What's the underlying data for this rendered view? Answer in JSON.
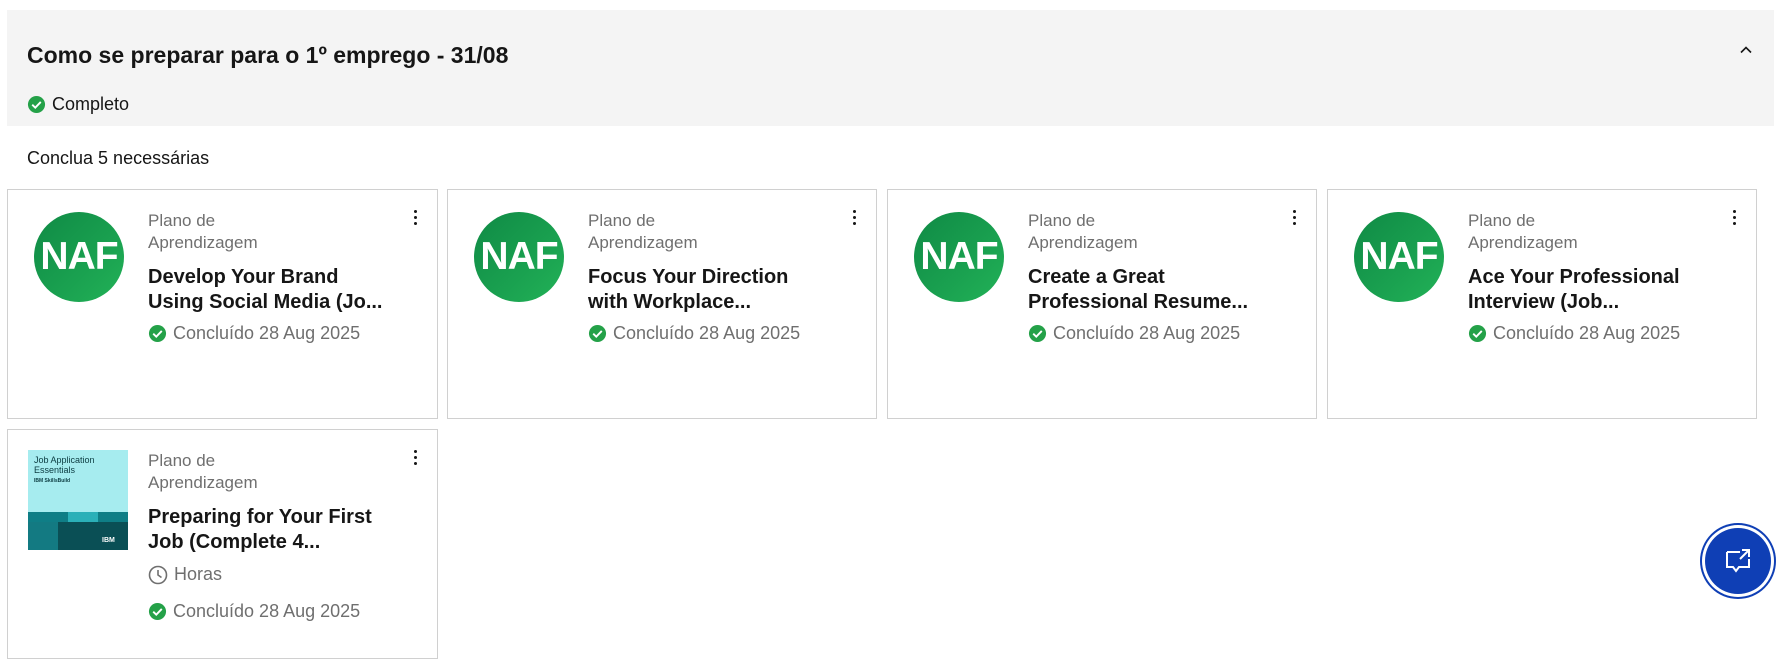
{
  "section": {
    "title": "Como se preparar para o 1º emprego - 31/08",
    "status": "Completo",
    "requirement": "Conclua 5 necessárias"
  },
  "cards": [
    {
      "kind": "Plano de Aprendizagem",
      "title": "Develop Your Brand Using Social Media (Jo...",
      "completed": "Concluído 28 Aug 2025",
      "thumb_text": "NAF"
    },
    {
      "kind": "Plano de Aprendizagem",
      "title": "Focus Your Direction with Workplace...",
      "completed": "Concluído 28 Aug 2025",
      "thumb_text": "NAF"
    },
    {
      "kind": "Plano de Aprendizagem",
      "title": "Create a Great Professional Resume...",
      "completed": "Concluído 28 Aug 2025",
      "thumb_text": "NAF"
    },
    {
      "kind": "Plano de Aprendizagem",
      "title": "Ace Your Professional Interview (Job...",
      "completed": "Concluído 28 Aug 2025",
      "thumb_text": "NAF"
    },
    {
      "kind": "Plano de Aprendizagem",
      "title": "Preparing for Your First Job (Complete 4...",
      "hours": "Horas",
      "completed": "Concluído 28 Aug 2025",
      "thumb_title": "Job Application Essentials",
      "thumb_brand": "IBM SkillsBuild",
      "thumb_logo": "IBM"
    }
  ],
  "colors": {
    "success": "#24a148",
    "header_bg": "#f4f4f4",
    "chat_button": "#0f3fb5",
    "naf_green": "#1aa150"
  },
  "icons": {
    "collapse": "chevron-up-icon",
    "status": "checkmark-filled-icon",
    "menu": "overflow-menu-vertical-icon",
    "hours": "clock-icon",
    "chat": "chat-launch-icon"
  }
}
